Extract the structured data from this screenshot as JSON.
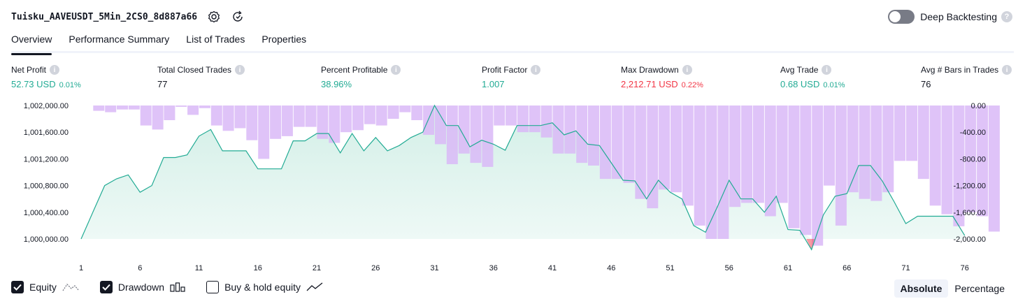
{
  "header": {
    "title": "Tuisku_AAVEUSDT_5Min_2CS0_8d887a66",
    "deep_backtesting_label": "Deep Backtesting",
    "deep_backtesting_enabled": false
  },
  "tabs": [
    {
      "label": "Overview",
      "active": true
    },
    {
      "label": "Performance Summary",
      "active": false
    },
    {
      "label": "List of Trades",
      "active": false
    },
    {
      "label": "Properties",
      "active": false
    }
  ],
  "metrics": [
    {
      "label": "Net Profit",
      "value": "52.73 USD",
      "pct": "0.01%",
      "color": "green"
    },
    {
      "label": "Total Closed Trades",
      "value": "77",
      "pct": "",
      "color": "dark"
    },
    {
      "label": "Percent Profitable",
      "value": "38.96%",
      "pct": "",
      "color": "green"
    },
    {
      "label": "Profit Factor",
      "value": "1.007",
      "pct": "",
      "color": "green"
    },
    {
      "label": "Max Drawdown",
      "value": "2,212.71 USD",
      "pct": "0.22%",
      "color": "red"
    },
    {
      "label": "Avg Trade",
      "value": "0.68 USD",
      "pct": "0.01%",
      "color": "green"
    },
    {
      "label": "Avg # Bars in Trades",
      "value": "76",
      "pct": "",
      "color": "dark"
    }
  ],
  "legend": {
    "equity": {
      "label": "Equity",
      "checked": true
    },
    "drawdown": {
      "label": "Drawdown",
      "checked": true
    },
    "buy_hold": {
      "label": "Buy & hold equity",
      "checked": false
    }
  },
  "scale": {
    "absolute": "Absolute",
    "percentage": "Percentage",
    "selected": "Absolute"
  },
  "colors": {
    "equity_line": "#22ab94",
    "equity_fill": "#d3efe7",
    "drawdown_bar": "#d9b8f7",
    "overlap": "#b8b2e6",
    "negative": "#f23645"
  },
  "chart_data": {
    "type": "area",
    "left_axis": {
      "ticks": [
        "1,002,000.00",
        "1,001,600.00",
        "1,001,200.00",
        "1,000,800.00",
        "1,000,400.00",
        "1,000,000.00"
      ],
      "range": [
        1000000,
        1002000
      ]
    },
    "right_axis": {
      "ticks": [
        "0.00",
        "-400.00",
        "-800.00",
        "-1,200.00",
        "-1,600.00",
        "-2,000.00"
      ],
      "range": [
        -2000,
        0
      ]
    },
    "x_ticks": [
      "1",
      "6",
      "11",
      "16",
      "21",
      "26",
      "31",
      "36",
      "41",
      "46",
      "51",
      "56",
      "61",
      "66",
      "71",
      "76"
    ],
    "trades": [
      1,
      2,
      3,
      4,
      5,
      6,
      7,
      8,
      9,
      10,
      11,
      12,
      13,
      14,
      15,
      16,
      17,
      18,
      19,
      20,
      21,
      22,
      23,
      24,
      25,
      26,
      27,
      28,
      29,
      30,
      31,
      32,
      33,
      34,
      35,
      36,
      37,
      38,
      39,
      40,
      41,
      42,
      43,
      44,
      45,
      46,
      47,
      48,
      49,
      50,
      51,
      52,
      53,
      54,
      55,
      56,
      57,
      58,
      59,
      60,
      61,
      62,
      63,
      64,
      65,
      66,
      67,
      68,
      69,
      70,
      71,
      72,
      73,
      74,
      75,
      76,
      77,
      78
    ],
    "series": [
      {
        "name": "Equity",
        "values": [
          1000000,
          1000400,
          1000800,
          1000900,
          1000960,
          1000700,
          1000800,
          1001220,
          1001220,
          1001260,
          1001540,
          1001640,
          1001320,
          1001320,
          1001320,
          1001050,
          1001050,
          1001050,
          1001470,
          1001470,
          1001580,
          1001580,
          1001290,
          1001580,
          1001320,
          1001520,
          1001320,
          1001400,
          1001520,
          1001600,
          1002000,
          1001700,
          1001700,
          1001380,
          1001480,
          1001420,
          1001330,
          1001700,
          1001700,
          1001700,
          1001740,
          1001560,
          1001620,
          1001420,
          1001400,
          1001140,
          1000880,
          1000870,
          1000600,
          1000880,
          1000700,
          1000600,
          1000200,
          1000100,
          1000480,
          1000880,
          1000600,
          1000600,
          1000400,
          1000640,
          1000140,
          1000130,
          999840,
          1000360,
          1000640,
          1000680,
          1001100,
          1001100,
          1000870,
          1000560,
          1000230,
          1000340,
          1000340,
          1000340,
          1000340,
          1000050
        ]
      },
      {
        "name": "Drawdown",
        "values": [
          0,
          -80,
          -100,
          -60,
          -60,
          -300,
          -360,
          -220,
          -20,
          -140,
          -40,
          -300,
          -380,
          -340,
          -520,
          -800,
          -500,
          -460,
          -320,
          -320,
          -500,
          -560,
          -400,
          -370,
          -280,
          -300,
          -200,
          -100,
          -220,
          -440,
          -580,
          -880,
          -720,
          -860,
          -920,
          -300,
          -300,
          -400,
          -400,
          -480,
          -720,
          -720,
          -860,
          -900,
          -1100,
          -1100,
          -1160,
          -1400,
          -1540,
          -1260,
          -1300,
          -1500,
          -1800,
          -2000,
          -2000,
          -1520,
          -1460,
          -1460,
          -1660,
          -1460,
          -1840,
          -1940,
          -2100,
          -1200,
          -1800,
          -1300,
          -1400,
          -1430,
          -1300,
          -830,
          -830,
          -1100,
          -1500,
          -1630,
          -1810,
          -1600,
          -1660,
          -1890
        ]
      }
    ]
  }
}
